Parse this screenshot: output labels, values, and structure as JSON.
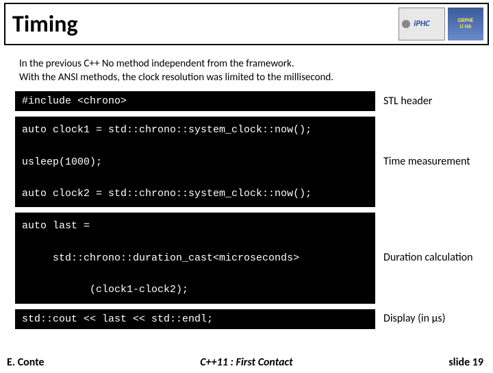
{
  "title": "Timing",
  "logos": {
    "iphc": "iPHC",
    "uha_line1": "GRPHE",
    "uha_line2": "U HA"
  },
  "intro_line1": "In the previous C++ No method independent from the framework.",
  "intro_line2": "With the ANSI methods, the clock resolution was limited to the millisecond.",
  "code1": "#include <chrono>",
  "label1": "STL header",
  "code2": "auto clock1 = std::chrono::system_clock::now();\n\nusleep(1000);\n\nauto clock2 = std::chrono::system_clock::now();",
  "label2": "Time measurement",
  "code3": "auto last =\n\n     std::chrono::duration_cast<microseconds>\n\n           (clock1-clock2);",
  "label3": "Duration calculation",
  "code4": "std::cout << last << std::endl;",
  "label4": "Display (in µs)",
  "footer": {
    "author": "E. Conte",
    "mid": "C++11 : First Contact",
    "slide": "slide 19"
  }
}
